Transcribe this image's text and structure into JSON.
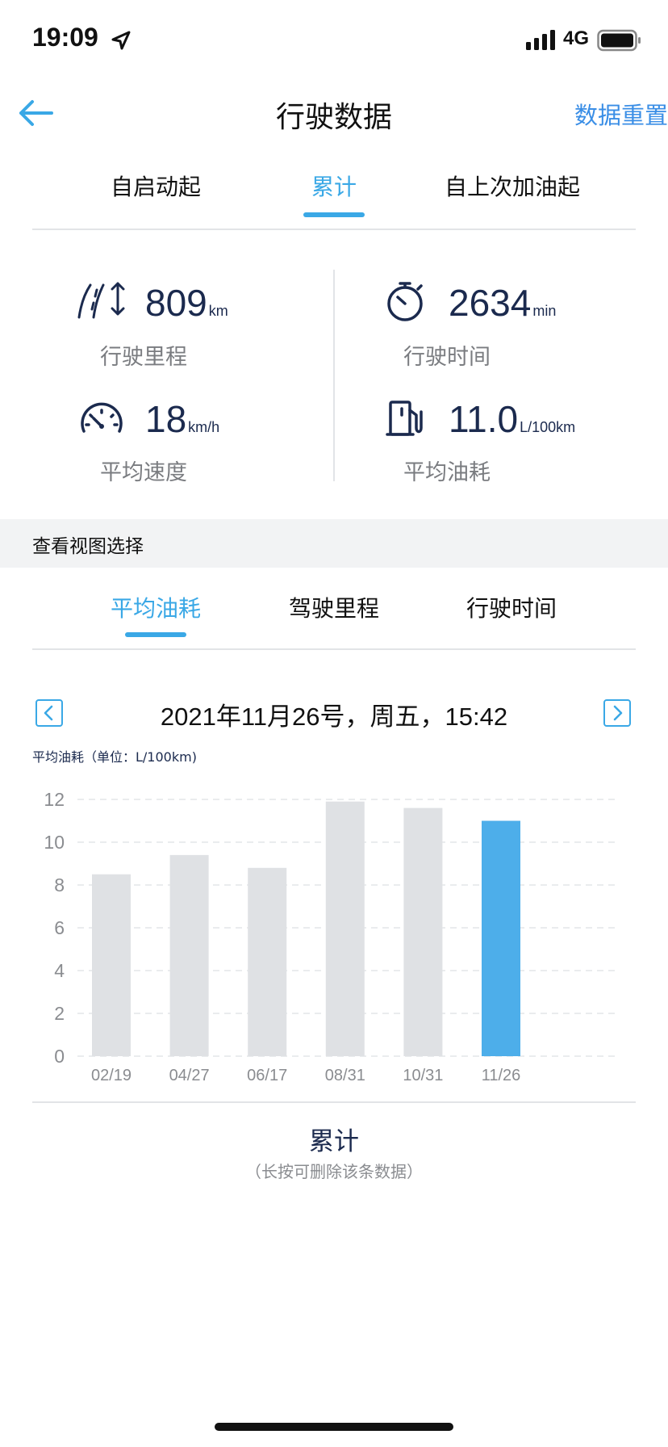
{
  "status_bar": {
    "time": "19:09",
    "network": "4G"
  },
  "header": {
    "title": "行驶数据",
    "reset_label": "数据重置"
  },
  "tabs": [
    {
      "label": "自启动起",
      "active": false
    },
    {
      "label": "累计",
      "active": true
    },
    {
      "label": "自上次加油起",
      "active": false
    }
  ],
  "stats": {
    "mileage": {
      "value": "809",
      "unit": "km",
      "label": "行驶里程"
    },
    "time": {
      "value": "2634",
      "unit": "min",
      "label": "行驶时间"
    },
    "speed": {
      "value": "18",
      "unit": "km/h",
      "label": "平均速度"
    },
    "fuel": {
      "value": "11.0",
      "unit": "L/100km",
      "label": "平均油耗"
    }
  },
  "view_section": {
    "title": "查看视图选择"
  },
  "view_tabs": [
    {
      "label": "平均油耗",
      "active": true
    },
    {
      "label": "驾驶里程",
      "active": false
    },
    {
      "label": "行驶时间",
      "active": false
    }
  ],
  "date_label": "2021年11月26号，周五，15:42",
  "chart_caption": "平均油耗（单位：L/100km)",
  "chart_data": {
    "type": "bar",
    "categories": [
      "02/19",
      "04/27",
      "06/17",
      "08/31",
      "10/31",
      "11/26"
    ],
    "values": [
      8.5,
      9.4,
      8.8,
      11.9,
      11.6,
      11.0
    ],
    "highlight_index": 5,
    "ylim": [
      0,
      12
    ],
    "yticks": [
      0,
      2,
      4,
      6,
      8,
      10,
      12
    ],
    "grid": true,
    "colors": {
      "bar": "#dfe1e4",
      "highlight": "#4daeea",
      "tick": "#8a8c90"
    }
  },
  "summary": {
    "title": "累计",
    "hint": "（长按可删除该条数据）"
  },
  "colors": {
    "accent": "#3aa8e6",
    "link": "#3a8ee6",
    "value": "#1b2a4e"
  }
}
